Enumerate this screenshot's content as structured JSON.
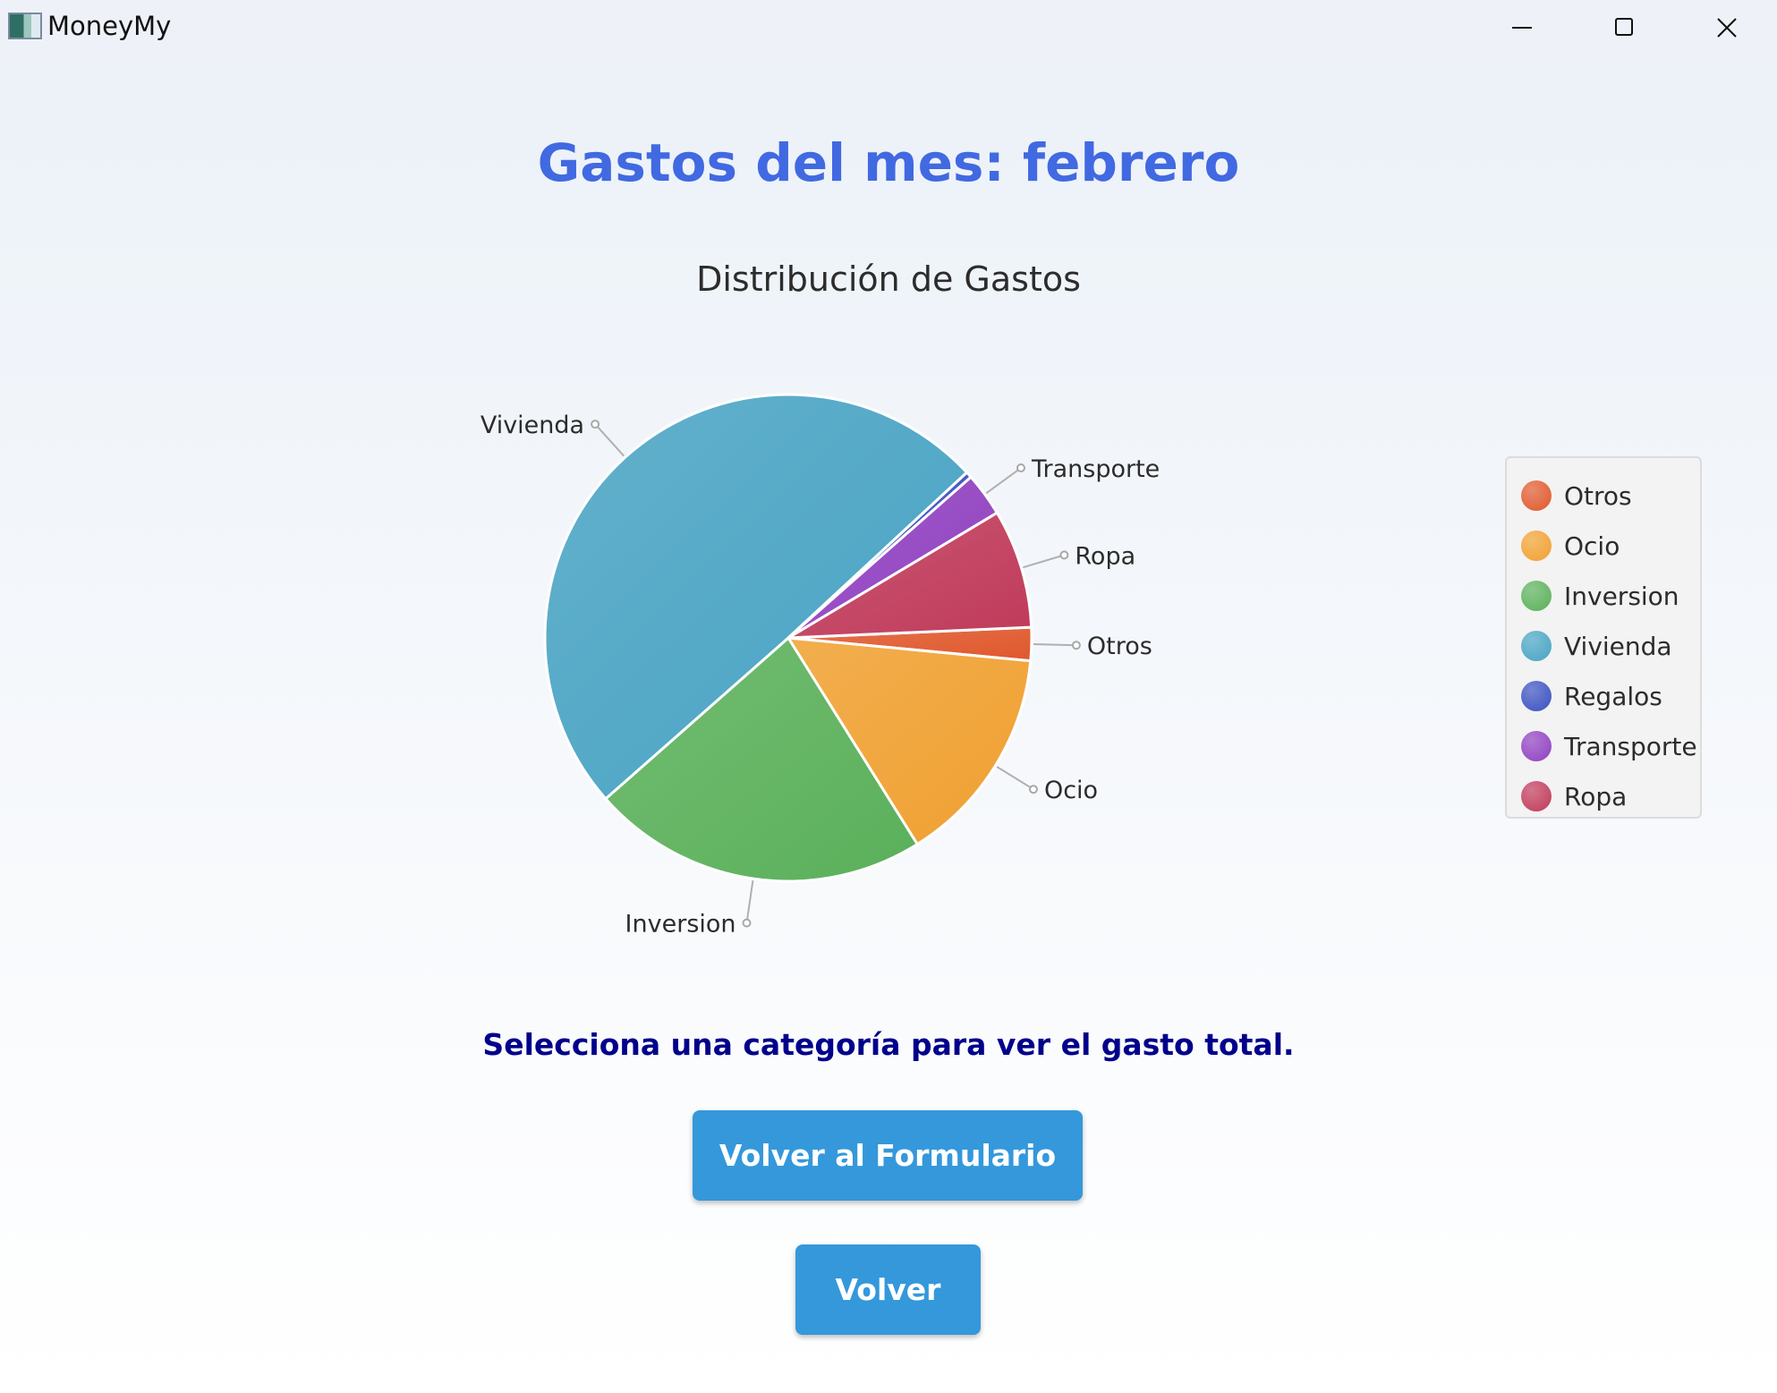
{
  "window": {
    "title": "MoneyMy",
    "minimize_icon": "minimize-icon",
    "maximize_icon": "maximize-icon",
    "close_icon": "close-icon"
  },
  "header": {
    "title": "Gastos del mes: febrero"
  },
  "chart_data": {
    "type": "pie",
    "title": "Distribución de Gastos",
    "slices": [
      {
        "label": "Otros",
        "value": 2.2,
        "color": "#e0582c"
      },
      {
        "label": "Ocio",
        "value": 14.6,
        "color": "#f0a030"
      },
      {
        "label": "Inversion",
        "value": 22.4,
        "color": "#5ab05a"
      },
      {
        "label": "Vivienda",
        "value": 49.6,
        "color": "#47a3c3"
      },
      {
        "label": "Regalos",
        "value": 0.4,
        "color": "#3a50c0"
      },
      {
        "label": "Transporte",
        "value": 2.9,
        "color": "#9040c0"
      },
      {
        "label": "Ropa",
        "value": 7.9,
        "color": "#c03a5a"
      }
    ],
    "legend": {
      "placement": "right",
      "items": [
        {
          "label": "Otros",
          "color": "#e0582c"
        },
        {
          "label": "Ocio",
          "color": "#f0a030"
        },
        {
          "label": "Inversion",
          "color": "#5ab05a"
        },
        {
          "label": "Vivienda",
          "color": "#47a3c3"
        },
        {
          "label": "Regalos",
          "color": "#3a50c0"
        },
        {
          "label": "Transporte",
          "color": "#9040c0"
        },
        {
          "label": "Ropa",
          "color": "#c03a5a"
        }
      ]
    }
  },
  "prompt": {
    "text": "Selecciona una categoría para ver el gasto total."
  },
  "buttons": {
    "form_label": "Volver al Formulario",
    "back_label": "Volver"
  },
  "colors": {
    "title": "#4169e1",
    "prompt": "#00008b",
    "button": "#3498db"
  }
}
